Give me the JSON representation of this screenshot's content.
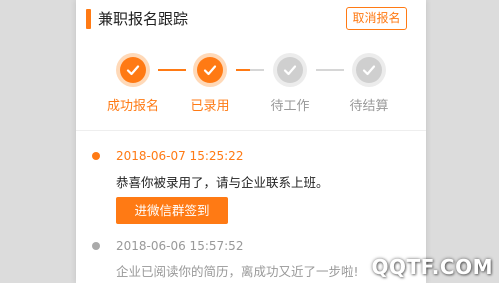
{
  "header": {
    "title": "兼职报名跟踪",
    "cancel_label": "取消报名"
  },
  "steps": [
    {
      "label": "成功报名",
      "status": "done"
    },
    {
      "label": "已录用",
      "status": "done"
    },
    {
      "label": "待工作",
      "status": "pending"
    },
    {
      "label": "待结算",
      "status": "pending"
    }
  ],
  "timeline": [
    {
      "date": "2018-06-07 15:25:22",
      "message": "恭喜你被录用了，请与企业联系上班。",
      "action_label": "进微信群签到",
      "highlight": true
    },
    {
      "date": "2018-06-06 15:57:52",
      "message": "企业已阅读你的简历，离成功又近了一步啦!",
      "highlight": false
    }
  ],
  "watermark": "QQTF.COM",
  "colors": {
    "accent": "#ff7a14",
    "accent_light": "#ffd9b8",
    "inactive": "#cfcfcf",
    "text_dark": "#222222",
    "text_gray": "#999999"
  }
}
